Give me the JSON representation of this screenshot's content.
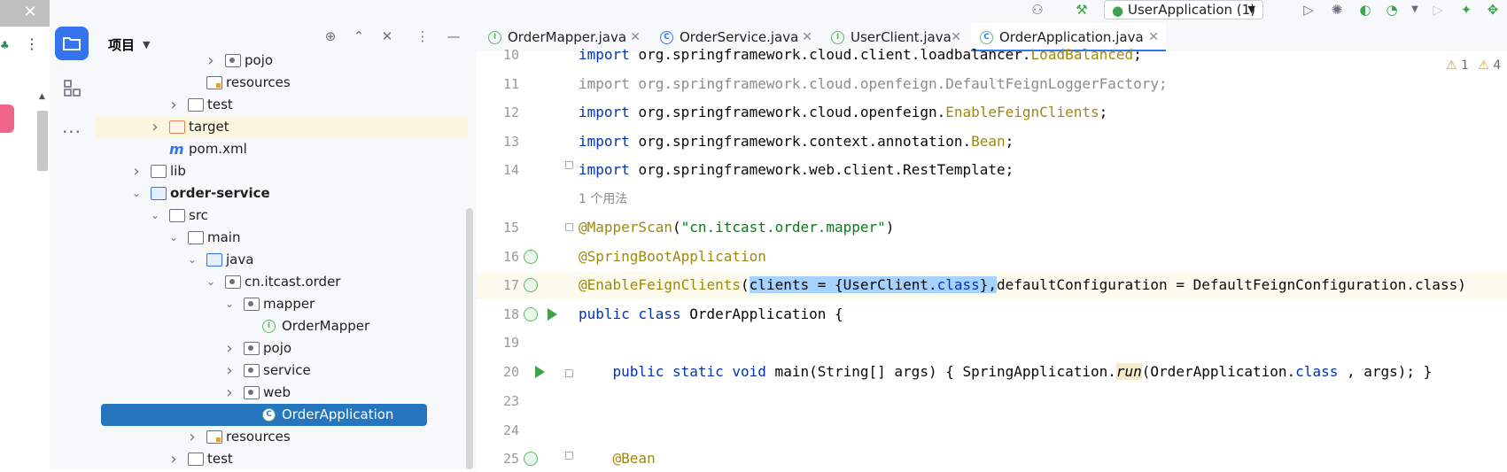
{
  "outer": {
    "close_glyph": "✕",
    "more_glyph": "⋮",
    "up_glyph": "▲"
  },
  "activity": {
    "more_glyph": "···"
  },
  "project_panel": {
    "title": "项目",
    "tools": [
      "target-icon",
      "expand-icon",
      "collapse-icon",
      "more-vertical-icon",
      "minimize-icon"
    ]
  },
  "tree": [
    {
      "label": "pojo",
      "indent": 6,
      "icon": "package",
      "arrow": "right"
    },
    {
      "label": "resources",
      "indent": 5,
      "icon": "resources",
      "arrow": ""
    },
    {
      "label": "test",
      "indent": 4,
      "icon": "folder",
      "arrow": "right"
    },
    {
      "label": "target",
      "indent": 3,
      "icon": "folder-orange",
      "arrow": "right",
      "highlight": true
    },
    {
      "label": "pom.xml",
      "indent": 3,
      "icon": "maven",
      "arrow": ""
    },
    {
      "label": "lib",
      "indent": 2,
      "icon": "folder",
      "arrow": "right"
    },
    {
      "label": "order-service",
      "indent": 2,
      "icon": "module",
      "arrow": "down",
      "bold": true
    },
    {
      "label": "src",
      "indent": 3,
      "icon": "folder",
      "arrow": "down"
    },
    {
      "label": "main",
      "indent": 4,
      "icon": "folder",
      "arrow": "down"
    },
    {
      "label": "java",
      "indent": 5,
      "icon": "folder-blue",
      "arrow": "down"
    },
    {
      "label": "cn.itcast.order",
      "indent": 6,
      "icon": "package",
      "arrow": "down"
    },
    {
      "label": "mapper",
      "indent": 7,
      "icon": "package",
      "arrow": "down"
    },
    {
      "label": "OrderMapper",
      "indent": 8,
      "icon": "interface",
      "arrow": ""
    },
    {
      "label": "pojo",
      "indent": 7,
      "icon": "package",
      "arrow": "right"
    },
    {
      "label": "service",
      "indent": 7,
      "icon": "package",
      "arrow": "right"
    },
    {
      "label": "web",
      "indent": 7,
      "icon": "package",
      "arrow": "right"
    },
    {
      "label": "OrderApplication",
      "indent": 8,
      "icon": "spring-class",
      "arrow": "",
      "selected": true
    },
    {
      "label": "resources",
      "indent": 5,
      "icon": "resources",
      "arrow": "right"
    },
    {
      "label": "test",
      "indent": 4,
      "icon": "folder",
      "arrow": "right"
    }
  ],
  "toolbar": {
    "run_config": "UserApplication (1)"
  },
  "tabs": [
    {
      "label": "OrderMapper.java",
      "icon": "I",
      "kind": "interface"
    },
    {
      "label": "OrderService.java",
      "icon": "C",
      "kind": "class"
    },
    {
      "label": "UserClient.java",
      "icon": "I",
      "kind": "interface"
    },
    {
      "label": "OrderApplication.java",
      "icon": "C",
      "kind": "spring-class",
      "active": true
    }
  ],
  "editor": {
    "warnings": {
      "weak": "1",
      "strong": "4"
    },
    "usage_hint": "1 个用法",
    "lines": [
      {
        "n": "10",
        "parts": [
          [
            "kw",
            "import"
          ],
          [
            "",
            "org.springframework.cloud.client.loadbalancer."
          ],
          [
            "ann",
            "LoadBalanced"
          ],
          [
            "",
            ";"
          ]
        ]
      },
      {
        "n": "11",
        "parts": [
          [
            "grey",
            "import org.springframework.cloud.openfeign.DefaultFeignLoggerFactory;"
          ]
        ]
      },
      {
        "n": "12",
        "parts": [
          [
            "kw",
            "import"
          ],
          [
            "",
            "org.springframework.cloud.openfeign."
          ],
          [
            "ann",
            "EnableFeignClients"
          ],
          [
            "",
            ";"
          ]
        ]
      },
      {
        "n": "13",
        "parts": [
          [
            "kw",
            "import"
          ],
          [
            "",
            "org.springframework.context.annotation."
          ],
          [
            "ann",
            "Bean"
          ],
          [
            "",
            ";"
          ]
        ]
      },
      {
        "n": "14",
        "parts": [
          [
            "kw",
            "import"
          ],
          [
            "",
            "org.springframework.web.client.RestTemplate;"
          ]
        ]
      },
      {
        "n": "15",
        "parts": [
          [
            "ann",
            "@MapperScan"
          ],
          [
            "",
            "("
          ],
          [
            "str",
            "\"cn.itcast.order.mapper\""
          ],
          [
            "",
            ")"
          ]
        ]
      },
      {
        "n": "16",
        "parts": [
          [
            "ann",
            "@SpringBootApplication"
          ]
        ]
      },
      {
        "n": "17",
        "parts": [
          [
            "ann",
            "@EnableFeignClients"
          ],
          [
            "",
            "("
          ],
          [
            "selx",
            "clients = {UserClient."
          ],
          [
            "selx kw",
            "class"
          ],
          [
            "selx",
            "},"
          ],
          [
            "",
            "defaultConfiguration = DefaultFeignConfiguration.class)"
          ]
        ]
      },
      {
        "n": "18",
        "parts": [
          [
            "kw",
            "public class"
          ],
          [
            "",
            " OrderApplication {"
          ]
        ]
      },
      {
        "n": "19",
        "parts": []
      },
      {
        "n": "20",
        "parts": [
          [
            "",
            "    "
          ],
          [
            "kw",
            "public static void"
          ],
          [
            "",
            " main(String[] args) { SpringApplication."
          ],
          [
            "it runhl",
            "run"
          ],
          [
            "",
            "(OrderApplication."
          ],
          [
            "kw",
            "class"
          ],
          [
            "",
            ", args); }"
          ]
        ]
      },
      {
        "n": "23",
        "parts": []
      },
      {
        "n": "24",
        "parts": []
      },
      {
        "n": "25",
        "parts": [
          [
            "",
            "    "
          ],
          [
            "ann",
            "@Bean"
          ]
        ]
      }
    ]
  }
}
